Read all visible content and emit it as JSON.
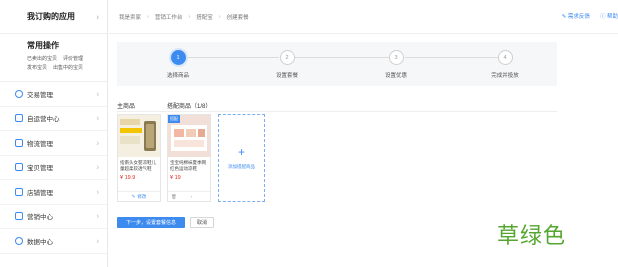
{
  "sidebar": {
    "header": "我订购的应用",
    "common_title": "常用操作",
    "common_links": [
      "已卖出的宝贝",
      "评价管理",
      "发布宝贝",
      "出售中的宝贝"
    ],
    "items": [
      {
        "label": "交易管理",
        "icon": "trade-icon"
      },
      {
        "label": "自运营中心",
        "icon": "chat-icon"
      },
      {
        "label": "物流管理",
        "icon": "truck-icon"
      },
      {
        "label": "宝贝管理",
        "icon": "box-icon"
      },
      {
        "label": "店铺管理",
        "icon": "store-icon"
      },
      {
        "label": "营销中心",
        "icon": "megaphone-icon"
      },
      {
        "label": "数据中心",
        "icon": "chart-icon"
      }
    ]
  },
  "breadcrumb": [
    "我是卖家",
    "营销工作台",
    "搭配宝",
    "创建套餐"
  ],
  "top_actions": {
    "feedback": "需求反馈",
    "help": "帮助"
  },
  "steps": [
    {
      "num": "1",
      "label": "选择商品",
      "active": true
    },
    {
      "num": "2",
      "label": "设置套餐",
      "active": false
    },
    {
      "num": "3",
      "label": "设置优惠",
      "active": false
    },
    {
      "num": "4",
      "label": "完成并投放",
      "active": false
    }
  ],
  "main_product": {
    "section_title": "主商品",
    "title": "指南头女婴凉鞋儿童超柔软透气鞋",
    "price": "¥ 19.9",
    "action": "修改"
  },
  "bundle": {
    "section_title": "搭配商品（1/8）",
    "badge": "搭配",
    "title": "宝宝纯棉袜夏季网红色运动凉鞋",
    "price": "¥ 19",
    "add_label": "添加搭配商品"
  },
  "buttons": {
    "next": "下一步，设置套餐信息",
    "cancel": "取消"
  },
  "caption": "草绿色",
  "colors": {
    "accent": "#3e8bf0",
    "price": "#e2231a",
    "caption": "#55a630"
  }
}
